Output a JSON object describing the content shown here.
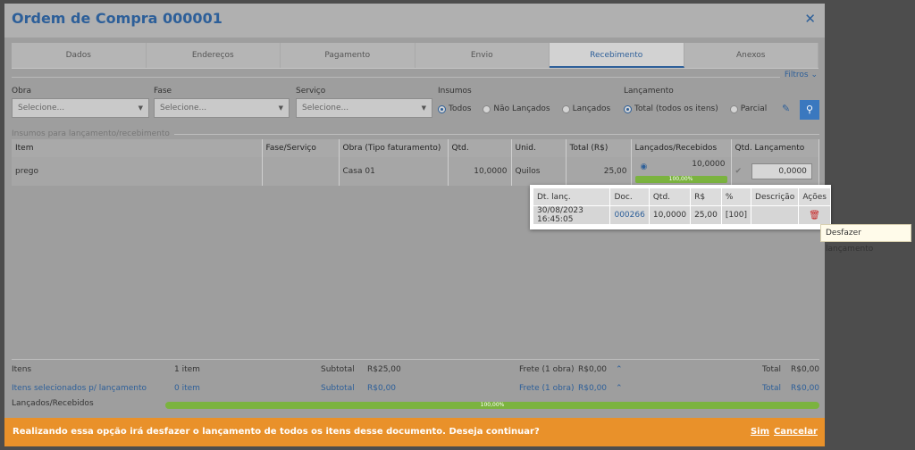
{
  "modal": {
    "title": "Ordem de Compra 000001",
    "close_glyph": "✕"
  },
  "tabs": [
    {
      "label": "Dados"
    },
    {
      "label": "Endereços"
    },
    {
      "label": "Pagamento"
    },
    {
      "label": "Envio"
    },
    {
      "label": "Recebimento"
    },
    {
      "label": "Anexos"
    }
  ],
  "active_tab": "Recebimento",
  "filters": {
    "toggle_label": "Filtros",
    "obra": {
      "label": "Obra",
      "placeholder": "Selecione..."
    },
    "fase": {
      "label": "Fase",
      "placeholder": "Selecione..."
    },
    "servico": {
      "label": "Serviço",
      "placeholder": "Selecione..."
    },
    "insumos": {
      "label": "Insumos",
      "options": [
        "Todos",
        "Não Lançados",
        "Lançados"
      ],
      "selected": "Todos"
    },
    "lancamento": {
      "label": "Lançamento",
      "options": [
        "Total (todos os itens)",
        "Parcial"
      ],
      "selected": "Total (todos os itens)"
    }
  },
  "section": {
    "title": "Insumos para lançamento/recebimento"
  },
  "table": {
    "headers": [
      "Item",
      "Fase/Serviço",
      "Obra (Tipo faturamento)",
      "Qtd.",
      "Unid.",
      "Total (R$)",
      "Lançados/Recebidos",
      "Qtd. Lançamento"
    ],
    "rows": [
      {
        "item": "prego",
        "fase_servico": "",
        "obra": "Casa 01",
        "qtd": "10,0000",
        "unid": "Quilos",
        "total": "25,00",
        "lancados": "10,0000",
        "progress_label": "100,00%",
        "progress": 1.0,
        "qtd_lancamento": "0,0000"
      }
    ]
  },
  "popup": {
    "headers": [
      "Dt. lanç.",
      "Doc.",
      "Qtd.",
      "R$",
      "%",
      "Descrição",
      "Ações"
    ],
    "rows": [
      {
        "dt": "30/08/2023 16:45:05",
        "doc": "000266",
        "qtd": "10,0000",
        "rs": "25,00",
        "pct": "[100]",
        "descricao": ""
      }
    ]
  },
  "tooltip": "Desfazer lançamento",
  "footer": {
    "itens": {
      "label": "Itens",
      "count": "1 item",
      "subtotal_label": "Subtotal",
      "subtotal": "R$25,00",
      "frete_label": "Frete (1 obra)",
      "frete": "R$0,00",
      "total_label": "Total",
      "total": "R$0,00"
    },
    "selecionados": {
      "label": "Itens selecionados p/ lançamento",
      "count": "0 item",
      "subtotal_label": "Subtotal",
      "subtotal": "R$0,00",
      "frete_label": "Frete (1 obra)",
      "frete": "R$0,00",
      "total_label": "Total",
      "total": "R$0,00"
    },
    "lancados": {
      "label": "Lançados/Recebidos",
      "progress_label": "100,00%",
      "progress": 1.0
    }
  },
  "confirm": {
    "message": "Realizando essa opção irá desfazer o lançamento de todos os itens desse documento. Deseja continuar?",
    "yes": "Sim",
    "no": "Cancelar"
  },
  "colors": {
    "accent": "#2d5f99",
    "progress": "#7bb33f",
    "confirm_bar": "#e9912a",
    "danger": "#c62828"
  }
}
